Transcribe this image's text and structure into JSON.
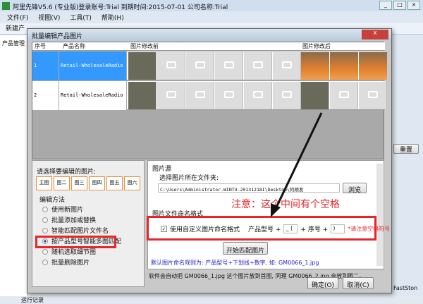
{
  "app": {
    "title": "阿里先锋V5.6 (专业版)登录账号:Trial  到期时间:2015-07-01   公司名称:Trial",
    "menu": [
      "文件(F)",
      "视图(V)",
      "工具(T)",
      "帮助(H)"
    ],
    "toolbar_first": "新建产",
    "left_label": "产品管理",
    "right_btn": "重置",
    "status": "运行记录",
    "taskbar": "FastSton"
  },
  "dialog": {
    "title": "批量编辑产品图片",
    "close": "x",
    "grid": {
      "headers": [
        "序号",
        "产品名称",
        "图片修改前",
        "图片修改后"
      ],
      "rows": [
        {
          "no": "1",
          "name": "Retail-WholesaleRadio",
          "selected": true
        },
        {
          "no": "2",
          "name": "Retail-WholesaleRadio",
          "selected": false
        }
      ]
    },
    "left": {
      "prompt": "请选择要编辑的图片:",
      "tabs": [
        "主图",
        "图二",
        "图三",
        "图四",
        "图五",
        "图六"
      ],
      "method_label": "编辑方法",
      "methods": [
        "使用新图片",
        "批量添加或替换",
        "智能匹配图片文件名",
        "按产品型号智能多图匹配",
        "随机选取细节图",
        "批量删除图片"
      ],
      "selected": 3
    },
    "right": {
      "source_label": "图片源",
      "folder_label": "选择图片所在文件夹:",
      "folder_path": "C:\\Users\\Administrator.WINTU-20131218I\\Desktop\\阿顺发",
      "browse": "浏览",
      "annotation": "注意：这个中间有个空格",
      "format_label": "图片文件命名格式",
      "custom_checkbox": "使用自定义图片命名格式",
      "custom_checked": true,
      "model_label": "产品型号 +",
      "prefix_value": "_ (",
      "seq_label": "+ 序号 +",
      "suffix_value": ")",
      "warning": "*请注意空格符号",
      "match_btn": "开始匹配图片",
      "rule": "默认图片命名规则为: 产品型号+下划线+数字, 如: GM0066_1.jpg",
      "explain": "软件会自动把 GM0066_1.jpg 这个图片放到首图, 同理 GM0066_2.jpg 会放到图二。"
    },
    "ok": "确定(O)",
    "cancel": "取消(C)"
  },
  "colors": {
    "accent_red": "#e8262a",
    "selected_row": "#3399ff",
    "rule_text": "#2222cc"
  }
}
